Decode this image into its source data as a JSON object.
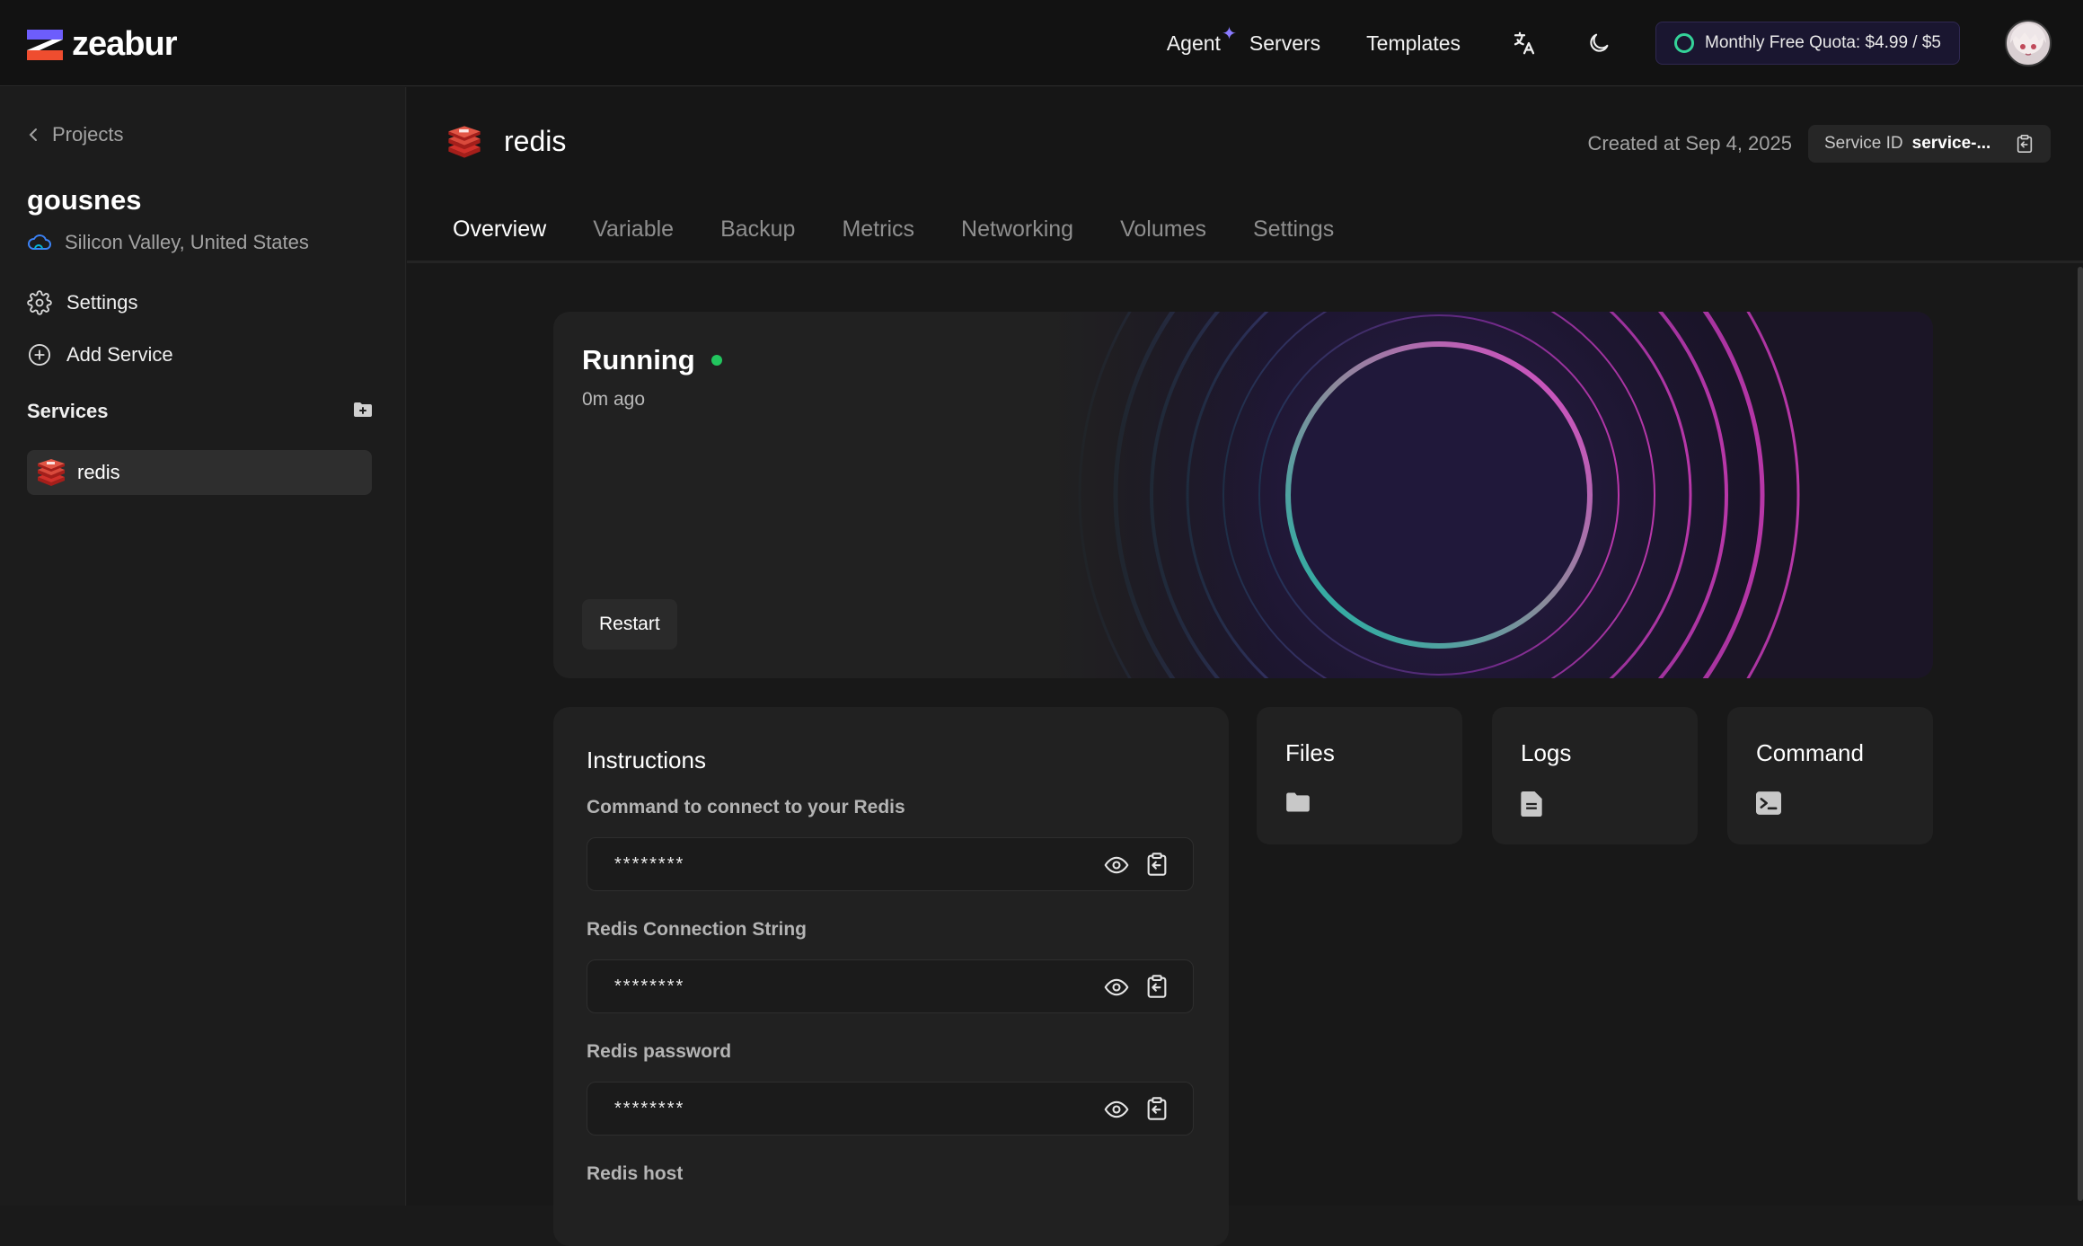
{
  "app": {
    "logo_text": "zeabur"
  },
  "nav": {
    "agent": "Agent",
    "servers": "Servers",
    "templates": "Templates",
    "quota": "Monthly Free Quota: $4.99 / $5"
  },
  "sidebar": {
    "back_label": "Projects",
    "project_name": "gousnes",
    "region": "Silicon Valley, United States",
    "settings_label": "Settings",
    "add_service_label": "Add Service",
    "services_title": "Services",
    "services": [
      {
        "name": "redis"
      }
    ]
  },
  "service": {
    "name": "redis",
    "created": "Created at Sep 4, 2025",
    "id_label": "Service ID",
    "id_value": "service-..."
  },
  "tabs": [
    "Overview",
    "Variable",
    "Backup",
    "Metrics",
    "Networking",
    "Volumes",
    "Settings"
  ],
  "status": {
    "state": "Running",
    "time": "0m ago",
    "restart_label": "Restart"
  },
  "instructions": {
    "title": "Instructions",
    "fields": [
      {
        "label": "Command to connect to your Redis",
        "value": "********"
      },
      {
        "label": "Redis Connection String",
        "value": "********"
      },
      {
        "label": "Redis password",
        "value": "********"
      },
      {
        "label": "Redis host",
        "value": ""
      }
    ]
  },
  "tools": [
    {
      "title": "Files",
      "icon": "folder-icon"
    },
    {
      "title": "Logs",
      "icon": "document-icon"
    },
    {
      "title": "Command",
      "icon": "terminal-icon"
    }
  ],
  "colors": {
    "accent": "#6d5dfc",
    "status_running": "#22c55e",
    "quota_ring": "#34d399",
    "redis_red": "#d0302a"
  }
}
